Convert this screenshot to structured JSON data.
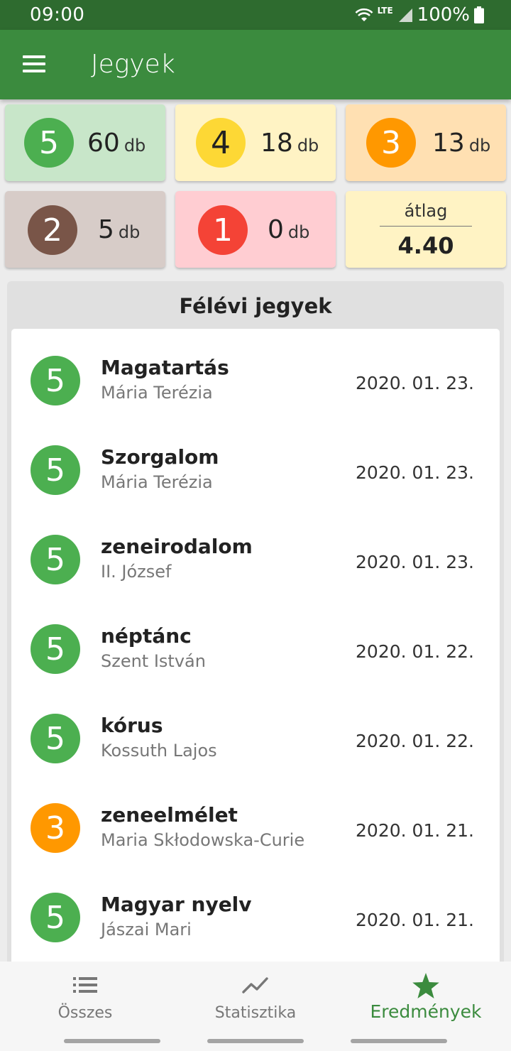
{
  "status_bar": {
    "time": "09:00",
    "network": "LTE",
    "battery": "100%",
    "icons": [
      "wifi-icon",
      "signal-icon",
      "battery-icon"
    ]
  },
  "app_bar": {
    "title": "Jegyek",
    "menu_icon": "hamburger-menu-icon"
  },
  "colors": {
    "grade_5": "#4caf50",
    "grade_4": "#fdd835",
    "grade_3": "#ff9800",
    "grade_2": "#795548",
    "grade_1": "#f44336",
    "primary": "#3b8b3e",
    "card_5": "#c8e6c9",
    "card_4": "#fff3c4",
    "card_3": "#ffe0b2",
    "card_2": "#d7ccc8",
    "card_1": "#ffcdd2",
    "card_avg": "#fff3c4"
  },
  "summary": {
    "unit": "db",
    "cards": [
      {
        "grade": "5",
        "count": "60"
      },
      {
        "grade": "4",
        "count": "18"
      },
      {
        "grade": "3",
        "count": "13"
      },
      {
        "grade": "2",
        "count": "5"
      },
      {
        "grade": "1",
        "count": "0"
      }
    ],
    "average": {
      "label": "átlag",
      "value": "4.40"
    }
  },
  "section": {
    "title": "Félévi jegyek",
    "grades": [
      {
        "grade": "5",
        "subject": "Magatartás",
        "teacher": "Mária Terézia",
        "date": "2020. 01. 23."
      },
      {
        "grade": "5",
        "subject": "Szorgalom",
        "teacher": "Mária Terézia",
        "date": "2020. 01. 23."
      },
      {
        "grade": "5",
        "subject": "zeneirodalom",
        "teacher": "II. József",
        "date": "2020. 01. 23."
      },
      {
        "grade": "5",
        "subject": "néptánc",
        "teacher": "Szent István",
        "date": "2020. 01. 22."
      },
      {
        "grade": "5",
        "subject": "kórus",
        "teacher": "Kossuth Lajos",
        "date": "2020. 01. 22."
      },
      {
        "grade": "3",
        "subject": "zeneelmélet",
        "teacher": "Maria Skłodowska-Curie",
        "date": "2020. 01. 21."
      },
      {
        "grade": "5",
        "subject": "Magyar nyelv",
        "teacher": "Jászai Mari",
        "date": "2020. 01. 21."
      }
    ]
  },
  "bottom_nav": {
    "items": [
      {
        "label": "Összes",
        "icon": "list-icon",
        "active": false
      },
      {
        "label": "Statisztika",
        "icon": "trending-chart-icon",
        "active": false
      },
      {
        "label": "Eredmények",
        "icon": "star-icon",
        "active": true
      }
    ]
  }
}
